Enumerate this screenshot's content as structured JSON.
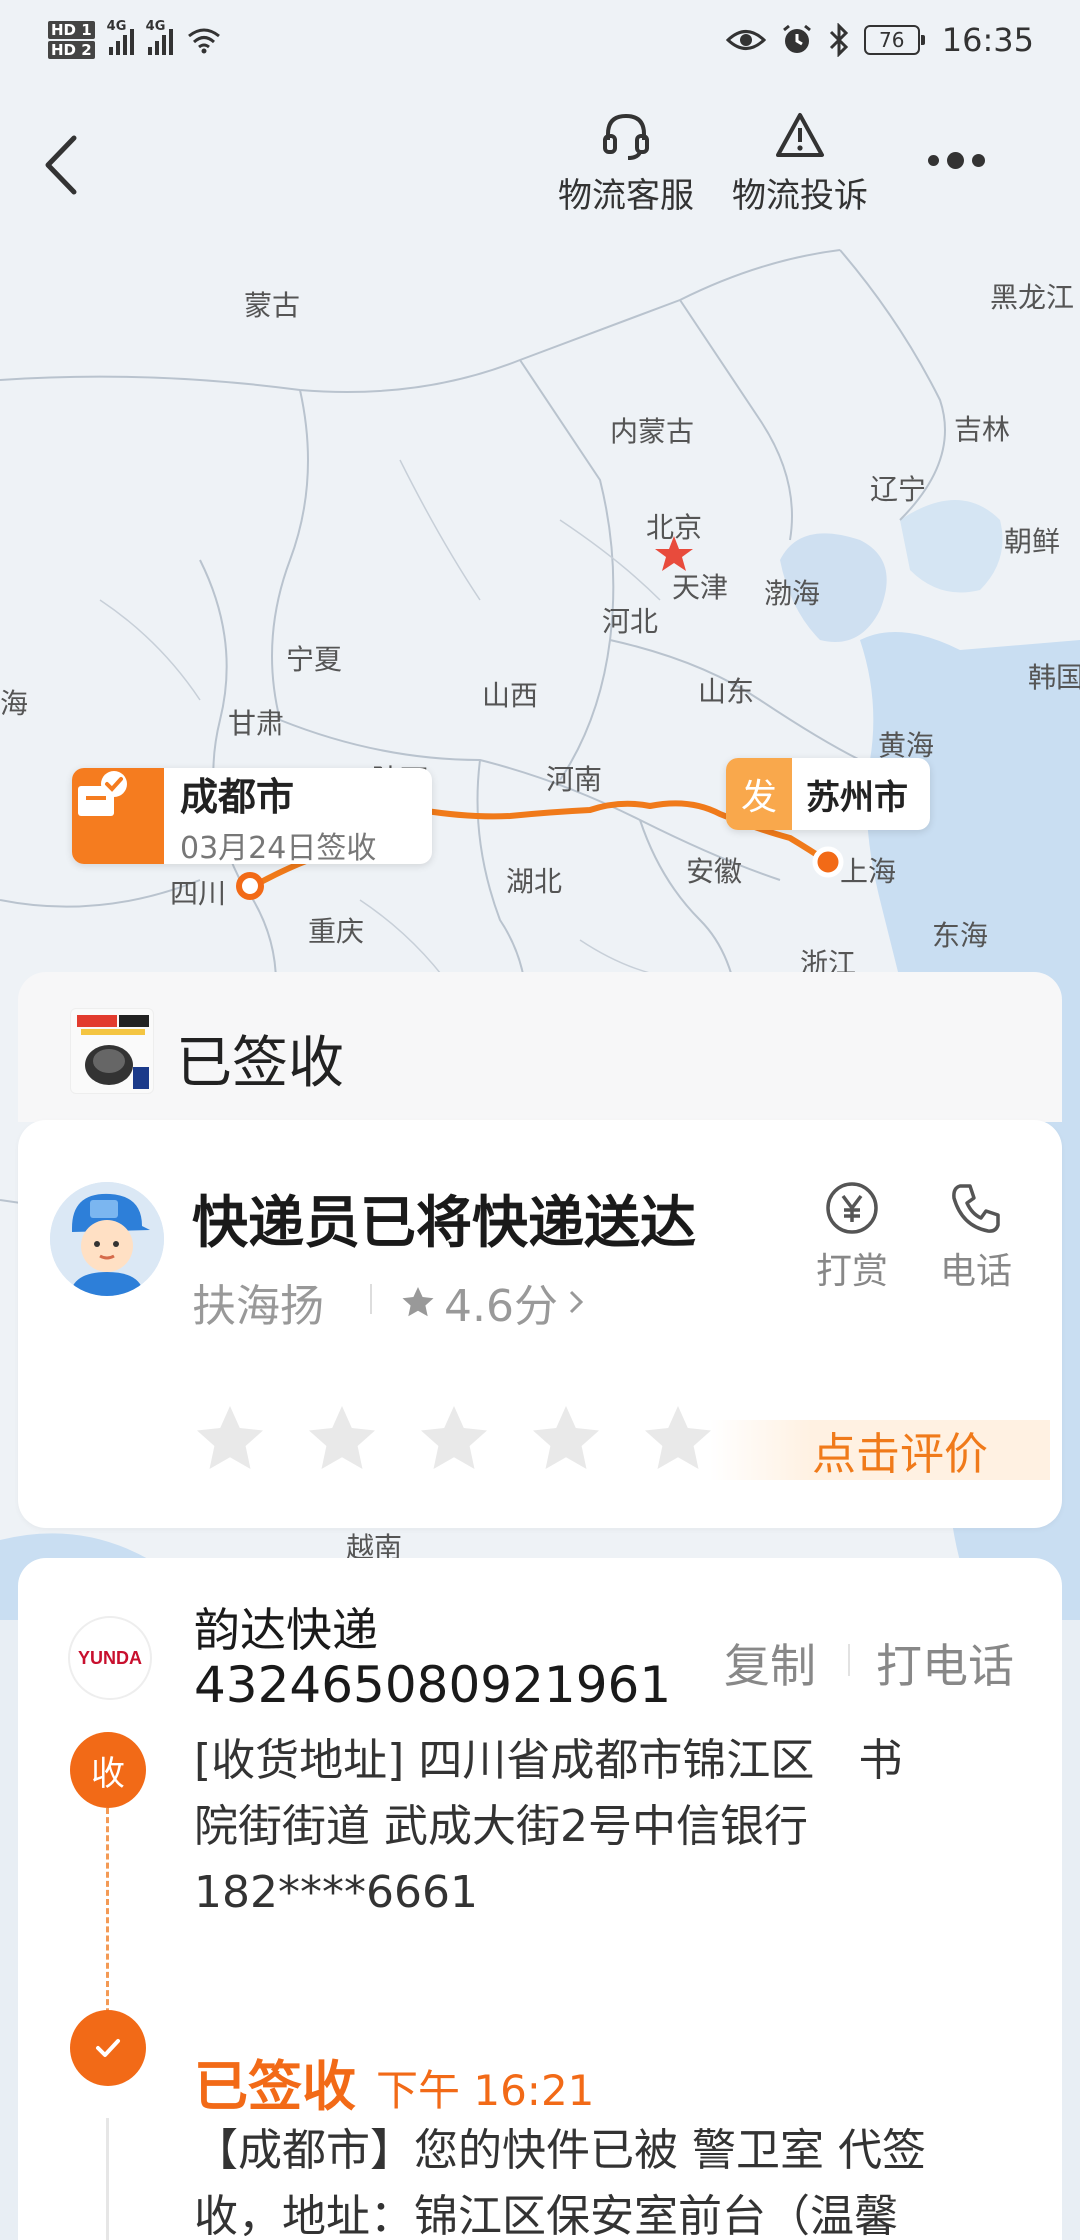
{
  "status_bar": {
    "time": "16:35",
    "battery": "76",
    "net1": "4G",
    "net2": "4G",
    "hd1": "HD 1",
    "hd2": "HD 2"
  },
  "nav": {
    "service_label": "物流客服",
    "complaint_label": "物流投诉"
  },
  "map": {
    "labels": [
      {
        "text": "蒙古"
      },
      {
        "text": "黑龙江"
      },
      {
        "text": "内蒙古"
      },
      {
        "text": "吉林"
      },
      {
        "text": "辽宁"
      },
      {
        "text": "北京"
      },
      {
        "text": "朝鲜"
      },
      {
        "text": "天津"
      },
      {
        "text": "渤海"
      },
      {
        "text": "河北"
      },
      {
        "text": "宁夏"
      },
      {
        "text": "韩国"
      },
      {
        "text": "海"
      },
      {
        "text": "山西"
      },
      {
        "text": "山东"
      },
      {
        "text": "甘肃"
      },
      {
        "text": "黄海"
      },
      {
        "text": "陕西"
      },
      {
        "text": "河南"
      },
      {
        "text": "湖北"
      },
      {
        "text": "安徽"
      },
      {
        "text": "上海"
      },
      {
        "text": "四川"
      },
      {
        "text": "重庆"
      },
      {
        "text": "浙江"
      },
      {
        "text": "东海"
      },
      {
        "text": "越南"
      }
    ],
    "origin": {
      "city": "成都市",
      "sub": "03月24日签收"
    },
    "destination": {
      "badge": "发",
      "city": "苏州市"
    }
  },
  "status": {
    "title": "已签收"
  },
  "courier": {
    "headline": "快递员已将快递送达",
    "name": "扶海扬",
    "rating": "4.6分",
    "tip_label": "打赏",
    "phone_label": "电话",
    "rate_cta": "点击评价"
  },
  "shipment": {
    "carrier": "韵达快递",
    "logo_text": "YUNDA",
    "tracking_no": "432465080921961",
    "copy_label": "复制",
    "call_label": "打电话",
    "receive_badge": "收",
    "address_lines": [
      "[收货地址] 四川省成都市锦江区　书",
      "院街街道 武成大街2号中信银行",
      "182****6661"
    ],
    "event_status": "已签收",
    "event_time": "下午 16:21",
    "event_lines": [
      "【成都市】您的快件已被 警卫室 代签",
      "收，地址：锦江区保安室前台（温馨"
    ]
  },
  "colors": {
    "accent": "#f26a17",
    "route": "#f07a1a",
    "map_bg": "#eef2f6",
    "sea": "#c9def2"
  }
}
